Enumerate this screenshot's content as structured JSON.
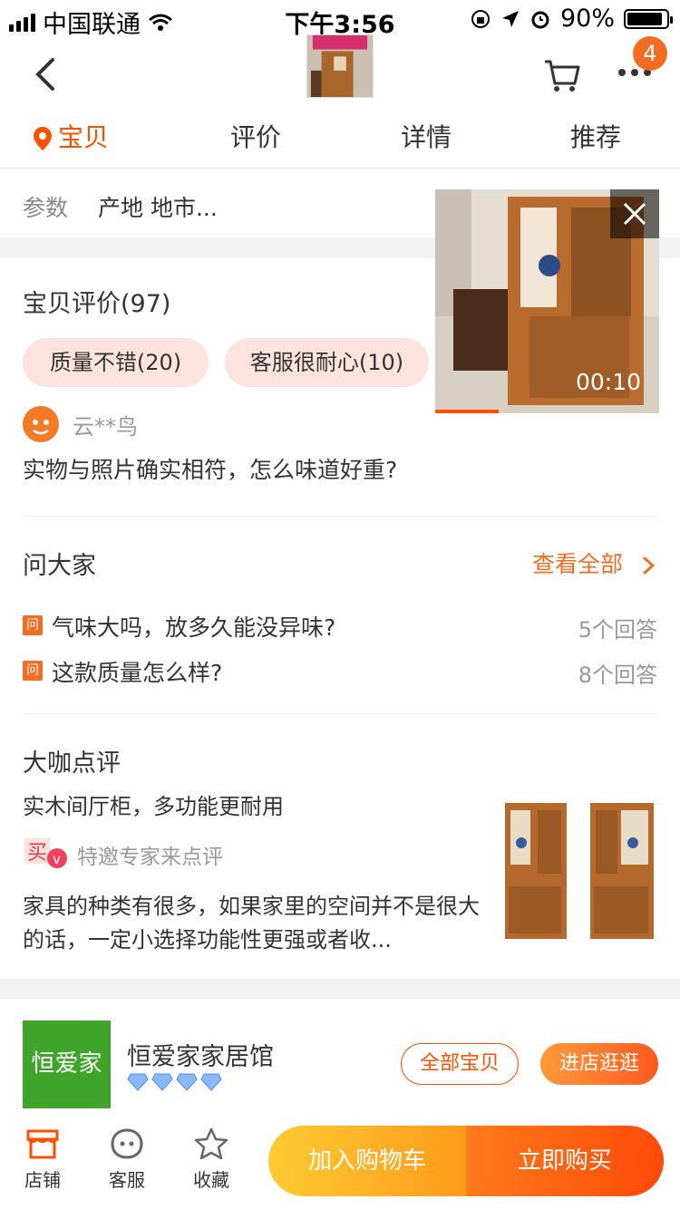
{
  "status": {
    "carrier": "中国联通",
    "time": "下午3:56",
    "battery": "90%"
  },
  "header": {
    "badge_count": "4"
  },
  "tabs": [
    {
      "label": "宝贝",
      "active": true
    },
    {
      "label": "评价"
    },
    {
      "label": "详情"
    },
    {
      "label": "推荐"
    }
  ],
  "params": {
    "key": "参数",
    "value": "产地 地市..."
  },
  "video": {
    "duration": "00:10",
    "progress": 0.28
  },
  "reviews": {
    "title": "宝贝评价(97)",
    "tags": [
      "质量不错(20)",
      "客服很耐心(10)"
    ],
    "user": "云**鸟",
    "text": "实物与照片确实相符，怎么味道好重?"
  },
  "ask": {
    "title": "问大家",
    "more": "查看全部",
    "questions": [
      {
        "icon": "问",
        "q": "气味大吗，放多久能没异味?",
        "a": "5个回答"
      },
      {
        "icon": "问",
        "q": "这款质量怎么样?",
        "a": "8个回答"
      }
    ]
  },
  "expert": {
    "title": "大咖点评",
    "subtitle": "实木间厅柜，多功能更耐用",
    "label": "特邀专家来点评",
    "body": "家具的种类有很多，如果家里的空间并不是很大的话，一定小选择功能性更强或者收..."
  },
  "shop": {
    "logo_text": "恒爱家",
    "name": "恒爱家家居馆",
    "all_btn": "全部宝贝",
    "enter_btn": "进店逛逛",
    "diamonds": 4
  },
  "bottom": {
    "shop": "店铺",
    "service": "客服",
    "fav": "收藏",
    "add_cart": "加入购物车",
    "buy_now": "立即购买"
  },
  "colors": {
    "accent": "#ff5000",
    "chip_bg": "#fde3de",
    "shop_logo": "#3fa52a"
  }
}
